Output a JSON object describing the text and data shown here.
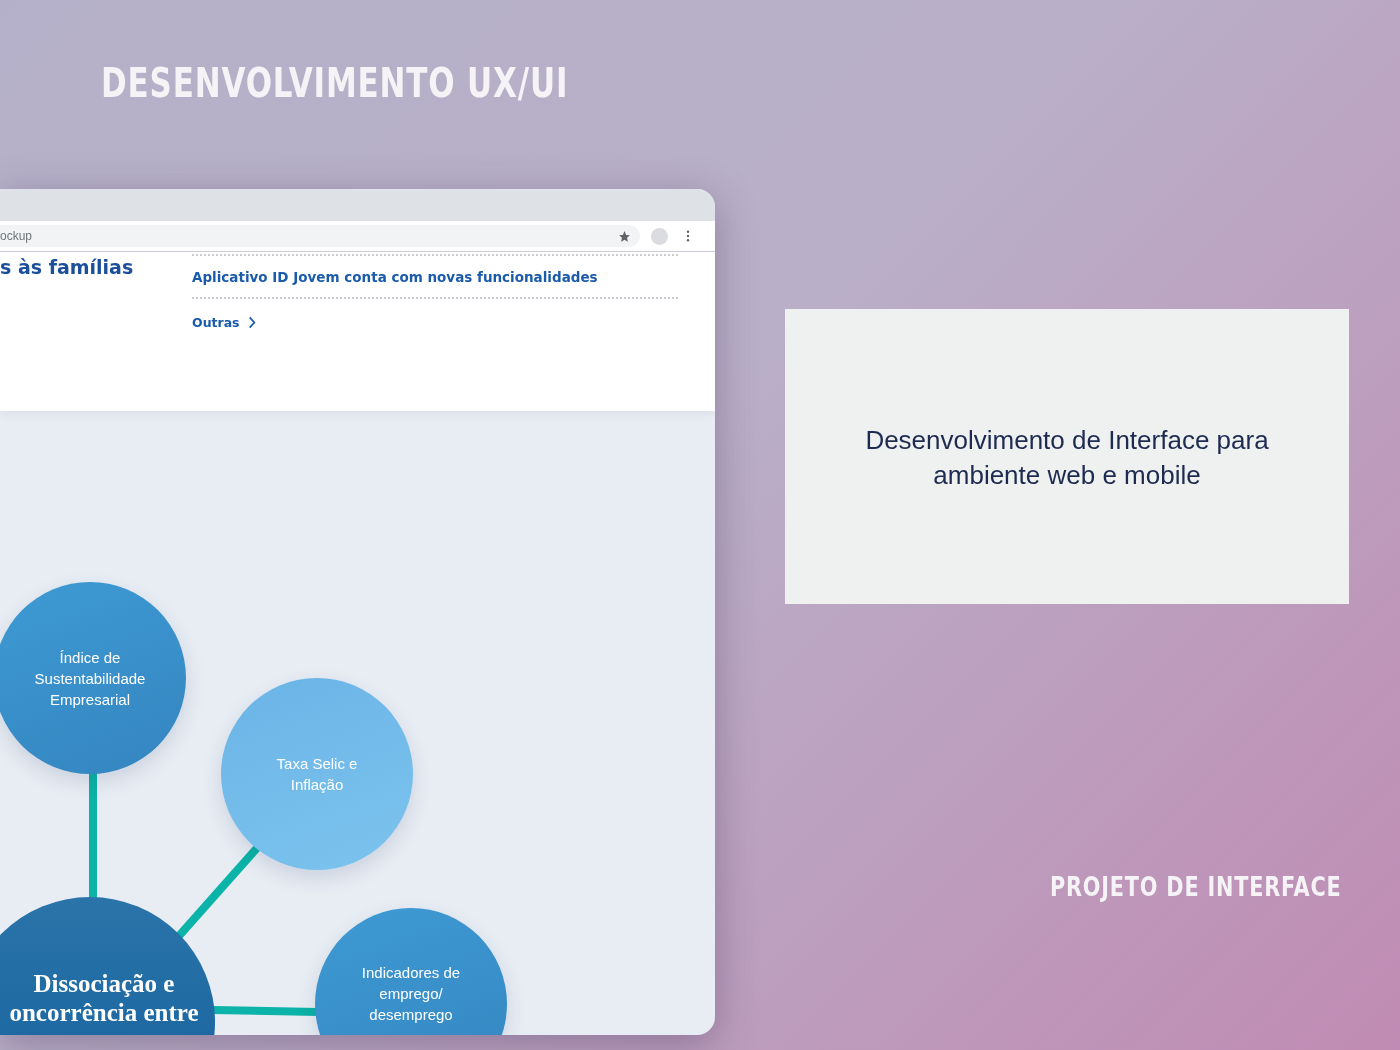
{
  "slide": {
    "title": "DESENVOLVIMENTO UX/UI",
    "description": "Desenvolvimento de Interface para ambiente web e mobile",
    "subtitle": "PROJETO DE INTERFACE"
  },
  "browser": {
    "address": "ockup",
    "news_heading": "s às famílias",
    "news_items": [
      "Aplicativo ID Jovem conta com novas funcionalidades"
    ],
    "more_link": "Outras",
    "diagram": {
      "center": "Dissociação e oncorrência entre",
      "nodes": [
        {
          "label": "Índice de Sustentabilidade Empresarial",
          "kind": "dark"
        },
        {
          "label": "Taxa Selic e Inflação",
          "kind": "light"
        },
        {
          "label": "Indicadores de emprego/ desemprego",
          "kind": "dark"
        }
      ]
    }
  }
}
